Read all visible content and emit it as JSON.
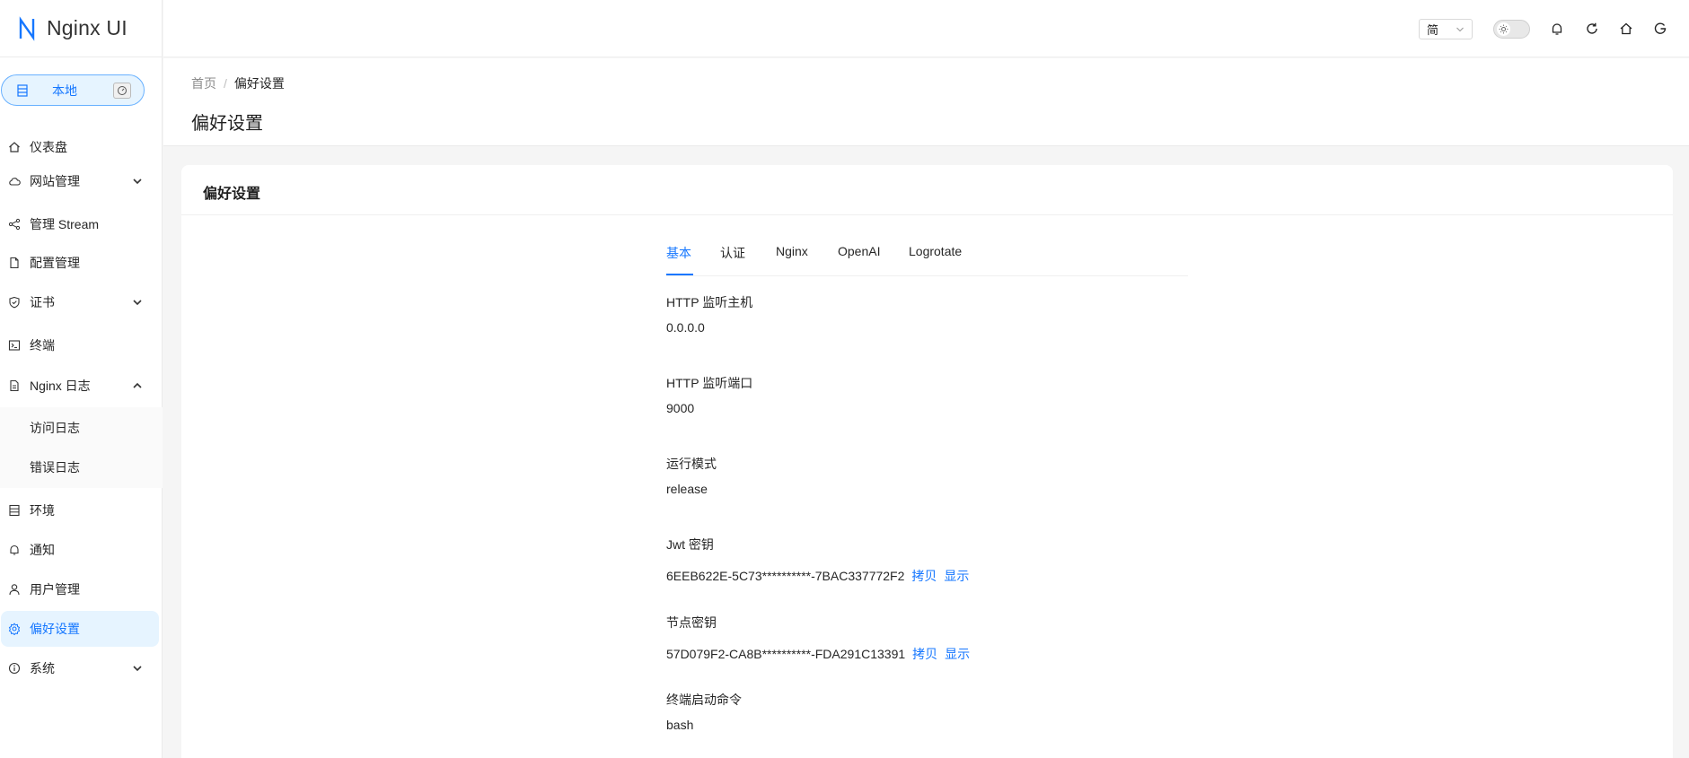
{
  "app": {
    "name": "Nginx UI"
  },
  "env": {
    "label": "本地"
  },
  "sidebar": {
    "items": [
      {
        "label": "仪表盘"
      },
      {
        "label": "网站管理"
      },
      {
        "label": "管理 Stream"
      },
      {
        "label": "配置管理"
      },
      {
        "label": "证书"
      },
      {
        "label": "终端"
      },
      {
        "label": "Nginx 日志"
      },
      {
        "label": "访问日志"
      },
      {
        "label": "错误日志"
      },
      {
        "label": "环境"
      },
      {
        "label": "通知"
      },
      {
        "label": "用户管理"
      },
      {
        "label": "偏好设置"
      },
      {
        "label": "系统"
      }
    ]
  },
  "header": {
    "language": "简"
  },
  "breadcrumb": {
    "home": "首页",
    "separator": "/",
    "current": "偏好设置"
  },
  "page": {
    "title": "偏好设置"
  },
  "card": {
    "title": "偏好设置"
  },
  "tabs": [
    {
      "label": "基本"
    },
    {
      "label": "认证"
    },
    {
      "label": "Nginx"
    },
    {
      "label": "OpenAI"
    },
    {
      "label": "Logrotate"
    }
  ],
  "fields": [
    {
      "label": "HTTP 监听主机",
      "value": "0.0.0.0"
    },
    {
      "label": "HTTP 监听端口",
      "value": "9000"
    },
    {
      "label": "运行模式",
      "value": "release"
    },
    {
      "label": "Jwt 密钥",
      "value": "6EEB622E-5C73**********-7BAC337772F2",
      "copy": "拷贝",
      "show": "显示"
    },
    {
      "label": "节点密钥",
      "value": "57D079F2-CA8B**********-FDA291C13391",
      "copy": "拷贝",
      "show": "显示"
    },
    {
      "label": "终端启动命令",
      "value": "bash"
    }
  ],
  "colors": {
    "accent": "#1677ff",
    "active_bg": "#e6f4ff"
  }
}
